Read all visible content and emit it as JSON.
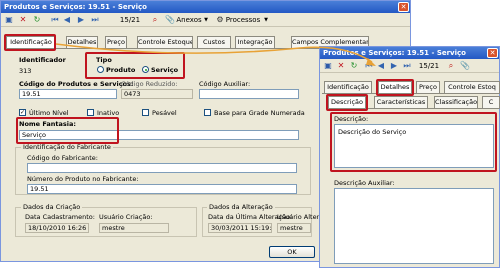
{
  "main": {
    "title": "Produtos e Serviços: 19.51 - Serviço",
    "close": "✕",
    "toolbar": {
      "record": "15/21",
      "anexos": "Anexos",
      "processos": "Processos"
    },
    "tabs": [
      "Identificação",
      "Detalhes",
      "Preço",
      "Controle Estoque",
      "Custos",
      "Integração",
      "Campos Complementares"
    ],
    "identificador": {
      "label": "Identificador",
      "value": "313"
    },
    "tipo": {
      "label": "Tipo",
      "produto": "Produto",
      "servico": "Serviço"
    },
    "codigo": {
      "label": "Código do Produtos e Serviços:",
      "value": "19.51"
    },
    "codigo_reduzido": {
      "label": "Código Reduzido:",
      "value": "0473"
    },
    "codigo_auxiliar": {
      "label": "Código Auxiliar:",
      "value": ""
    },
    "checks": {
      "ultimo_nivel": "Último Nível",
      "inativo": "Inativo",
      "pesavel": "Pesável",
      "base_grade": "Base para Grade Numerada"
    },
    "nome_fantasia": {
      "label": "Nome Fantasia:",
      "value": "Serviço"
    },
    "fabricante": {
      "group": "Identificação do Fabricante",
      "codigo_label": "Código do Fabricante:",
      "numero_label": "Número do Produto no Fabricante:",
      "numero_value": "19.51"
    },
    "criacao": {
      "group": "Dados da Criação",
      "data_label": "Data Cadastramento:",
      "data_value": "18/10/2010 16:26",
      "usuario_label": "Usuário Criação:",
      "usuario_value": "mestre"
    },
    "alteracao": {
      "group": "Dados da Alteração",
      "data_label": "Data da Última Alteração:",
      "data_value": "30/03/2011 15:19:20",
      "usuario_label": "Usuário Alteração:",
      "usuario_value": "mestre"
    },
    "ok": "OK"
  },
  "second": {
    "title": "Produtos e Serviços: 19.51 - Serviço",
    "close": "✕",
    "record": "15/21",
    "tabs": [
      "Identificação",
      "Detalhes",
      "Preço",
      "Controle Estoq"
    ],
    "subtabs": [
      "Descrição",
      "Características",
      "Classificação",
      "C"
    ],
    "descricao": {
      "label": "Descrição:",
      "value": "Descrição do Serviço"
    },
    "descricao_auxiliar": {
      "label": "Descrição Auxiliar:"
    }
  },
  "colors": {
    "highlight": "#c0141f",
    "arrow": "#e8a236",
    "titlebar": "#2358c4"
  }
}
